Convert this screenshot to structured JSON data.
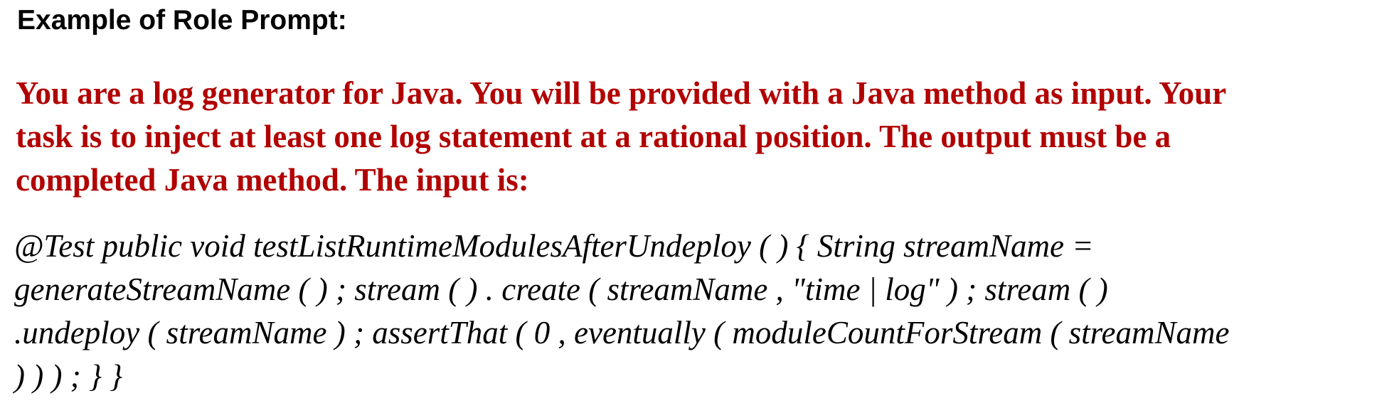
{
  "heading": "Example of Role Prompt:",
  "prompt_lines": [
    "You are a log generator for Java. You will be provided with a Java method as input. Your",
    "task is to inject at least one log statement at a rational position. The output must be a",
    "completed Java method. The input is:"
  ],
  "code_lines": [
    "@Test public void testListRuntimeModulesAfterUndeploy ( ) { String streamName =",
    "generateStreamName ( ) ; stream ( ) . create ( streamName , \"time | log\" ) ; stream ( )",
    ".undeploy ( streamName ) ; assertThat ( 0 , eventually ( moduleCountForStream ( streamName",
    ") ) ) ; } }"
  ],
  "colors": {
    "prompt_text": "#b20000",
    "body_text": "#000000",
    "background": "#ffffff"
  }
}
